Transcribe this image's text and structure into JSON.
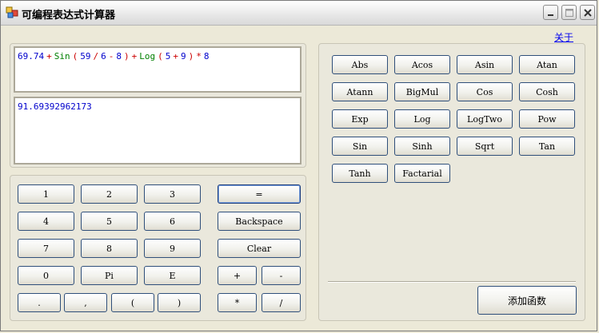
{
  "window": {
    "title": "可编程表达式计算器"
  },
  "about_link": "关于",
  "expression": {
    "tokens": [
      {
        "text": "69.74",
        "color": "#0000cc"
      },
      {
        "text": "+",
        "color": "#cc0000"
      },
      {
        "text": "Sin",
        "color": "#008000"
      },
      {
        "text": "(",
        "color": "#cc0000"
      },
      {
        "text": "59",
        "color": "#0000cc"
      },
      {
        "text": "/",
        "color": "#cc0000"
      },
      {
        "text": "6",
        "color": "#0000cc"
      },
      {
        "text": "-",
        "color": "#cc0000"
      },
      {
        "text": "8",
        "color": "#0000cc"
      },
      {
        "text": ")",
        "color": "#cc0000"
      },
      {
        "text": "+",
        "color": "#cc0000"
      },
      {
        "text": "Log",
        "color": "#008000"
      },
      {
        "text": "(",
        "color": "#cc0000"
      },
      {
        "text": "5",
        "color": "#0000cc"
      },
      {
        "text": "+",
        "color": "#cc0000"
      },
      {
        "text": "9",
        "color": "#0000cc"
      },
      {
        "text": ")",
        "color": "#cc0000"
      },
      {
        "text": "*",
        "color": "#cc0000"
      },
      {
        "text": "8",
        "color": "#0000cc"
      }
    ]
  },
  "result": {
    "text": "91.69392962173",
    "color": "#0000cc"
  },
  "keypad": {
    "row1": [
      "1",
      "2",
      "3"
    ],
    "row2": [
      "4",
      "5",
      "6"
    ],
    "row3": [
      "7",
      "8",
      "9"
    ],
    "row4": [
      "0",
      "Pi",
      "E"
    ],
    "row5": [
      ".",
      ",",
      "(",
      ")"
    ],
    "equals": "=",
    "backspace": "Backspace",
    "clear": "Clear",
    "plus": "+",
    "minus": "-",
    "multiply": "*",
    "divide": "/"
  },
  "functions": [
    [
      "Abs",
      "Acos",
      "Asin",
      "Atan"
    ],
    [
      "Atann",
      "BigMul",
      "Cos",
      "Cosh"
    ],
    [
      "Exp",
      "Log",
      "LogTwo",
      "Pow"
    ],
    [
      "Sin",
      "Sinh",
      "Sqrt",
      "Tan"
    ],
    [
      "Tanh",
      "Factarial"
    ]
  ],
  "add_function_button": "添加函数"
}
